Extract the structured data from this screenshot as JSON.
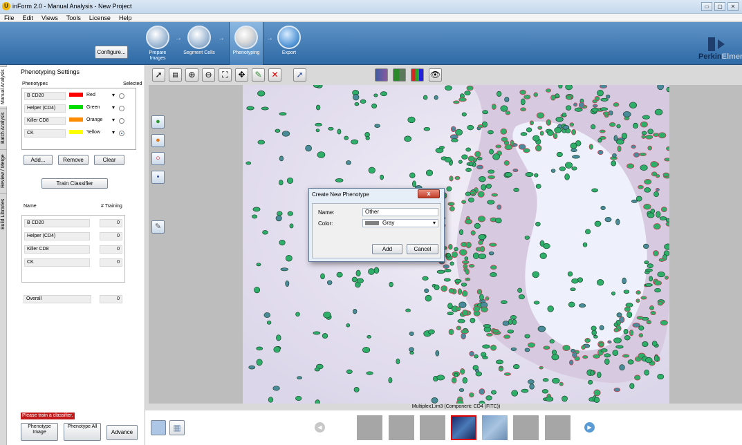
{
  "window": {
    "title": "inForm 2.0 - Manual  Analysis - New Project",
    "controls": [
      "▭",
      "▢",
      "✕"
    ]
  },
  "menu": [
    "File",
    "Edit",
    "Views",
    "Tools",
    "License",
    "Help"
  ],
  "ribbon": {
    "configure_label": "Configure...",
    "workflow": [
      {
        "label": "Prepare Images",
        "icon": "funnel-icon"
      },
      {
        "label": "Segment Cells",
        "icon": "cells-icon"
      },
      {
        "label": "Phenotyping",
        "icon": "phenotyping-icon",
        "active": true
      },
      {
        "label": "Export",
        "icon": "export-arrow-icon"
      }
    ],
    "logo_text_a": "Perkin",
    "logo_text_b": "Elmer"
  },
  "side_tabs": [
    "Manual Analysis",
    "Batch Analysis",
    "Review / Merge",
    "Build Libraries"
  ],
  "panel": {
    "title": "Phenotyping Settings",
    "phenotypes_header": "Phenotypes",
    "selected_header": "Selected",
    "phenotypes": [
      {
        "name": "B CD20",
        "color_name": "Red",
        "color": "#ff0000",
        "selected": false
      },
      {
        "name": "Helper (CD4)",
        "color_name": "Green",
        "color": "#00dd00",
        "selected": false
      },
      {
        "name": "Killer CD8",
        "color_name": "Orange",
        "color": "#ff8c00",
        "selected": false
      },
      {
        "name": "CK",
        "color_name": "Yellow",
        "color": "#ffff00",
        "selected": true
      }
    ],
    "add_label": "Add...",
    "remove_label": "Remove",
    "clear_label": "Clear",
    "train_label": "Train Classifier",
    "name_header": "Name",
    "training_header": "# Training",
    "training_rows": [
      {
        "name": "B CD20",
        "count": "0"
      },
      {
        "name": "Helper (CD4)",
        "count": "0"
      },
      {
        "name": "Killer CD8",
        "count": "0"
      },
      {
        "name": "CK",
        "count": "0"
      }
    ],
    "overall_label": "Overall",
    "overall_value": "0",
    "warning": "Please train a classifier.",
    "phenotype_image_label": "Phenotype Image",
    "phenotype_all_label": "Phenotype All",
    "advance_label": "Advance"
  },
  "toolbar_icons": [
    "pointer-icon",
    "select-region-icon",
    "zoom-in-icon",
    "zoom-out-icon",
    "fit-icon",
    "pan-icon",
    "draw-icon",
    "delete-icon",
    "pick-cell-icon"
  ],
  "view_icons": [
    "composite-view-icon",
    "component-view-icon",
    "rgb-view-icon",
    "eye-icon"
  ],
  "side_tools": [
    "green-cell-tool-icon",
    "orange-cell-tool-icon",
    "red-outline-tool-icon",
    "blue-cell-tool-icon",
    "edit-tool-icon"
  ],
  "dialog": {
    "title": "Create New Phenotype",
    "close": "x",
    "name_label": "Name:",
    "name_value": "Other",
    "color_label": "Color:",
    "color_value": "Gray",
    "color_swatch": "#808080",
    "add_label": "Add",
    "cancel_label": "Cancel"
  },
  "image_caption": "Multiplex1.im3  (Component: CD4 (FITC))"
}
